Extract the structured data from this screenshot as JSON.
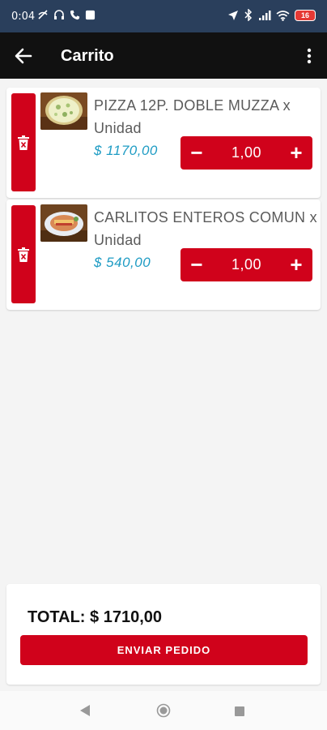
{
  "status_bar": {
    "time": "0:04",
    "battery": "16"
  },
  "app_bar": {
    "title": "Carrito"
  },
  "items": [
    {
      "name": "PIZZA 12P. DOBLE MUZZA x Unidad",
      "price": "$ 1170,00",
      "quantity": "1,00",
      "minus": "−",
      "plus": "+"
    },
    {
      "name": "CARLITOS ENTEROS COMUN  x Unidad",
      "price": "$ 540,00",
      "quantity": "1,00",
      "minus": "−",
      "plus": "+"
    }
  ],
  "footer": {
    "total": "TOTAL: $ 1710,00",
    "send_label": "ENVIAR PEDIDO"
  },
  "colors": {
    "accent": "#d0021b",
    "price": "#1f9cc4",
    "status_bar": "#2a3f5c",
    "app_bar": "#111111"
  }
}
